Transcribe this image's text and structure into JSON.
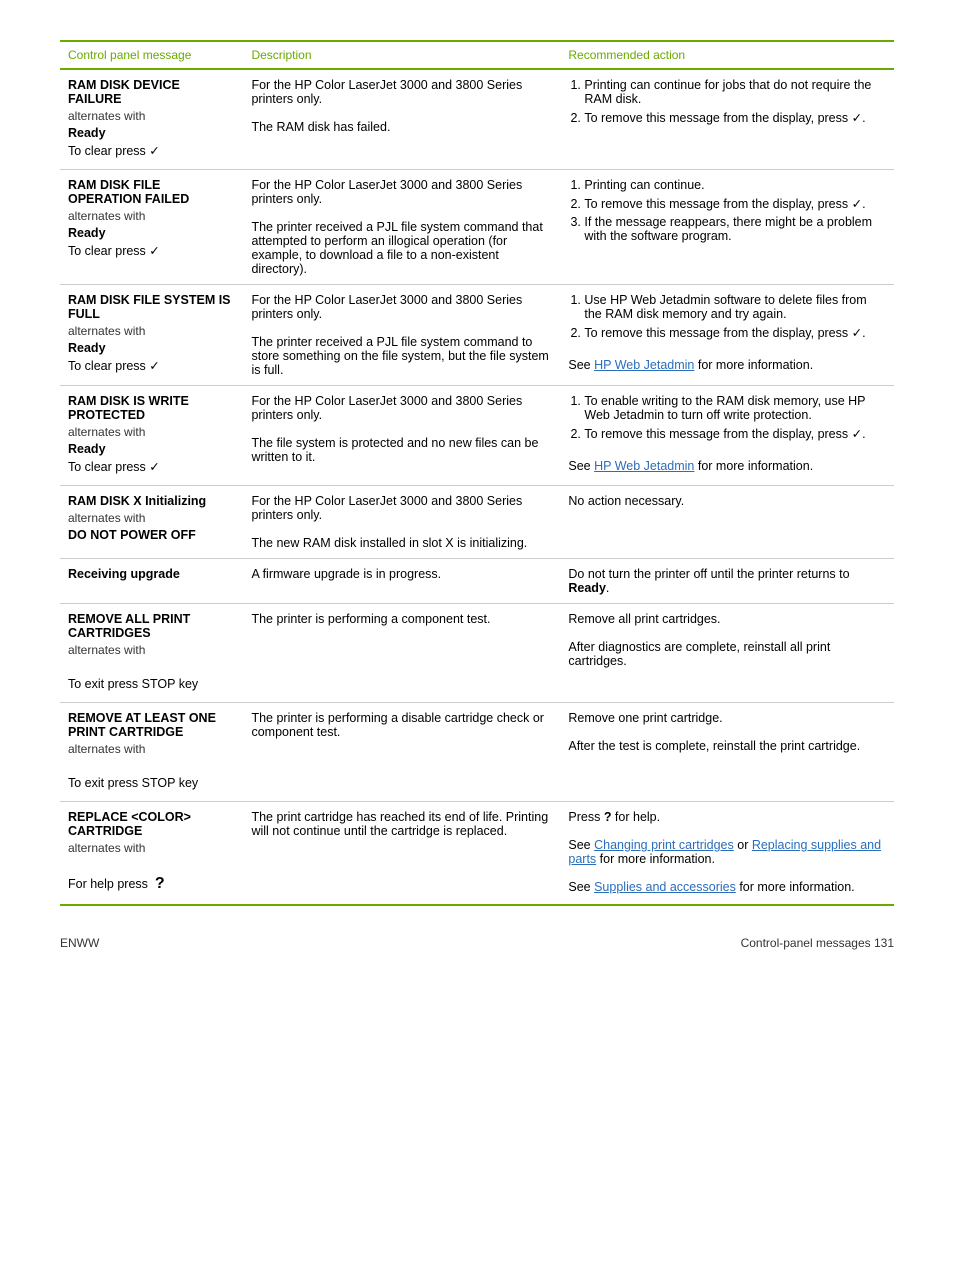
{
  "table": {
    "headers": {
      "col1": "Control panel message",
      "col2": "Description",
      "col3": "Recommended action"
    },
    "rows": [
      {
        "id": "row1",
        "col1": {
          "main": "RAM DISK DEVICE FAILURE",
          "alternates": "alternates with",
          "sub": "Ready",
          "clear": "To clear press ✓"
        },
        "col2": {
          "lines": [
            "For the HP Color LaserJet 3000 and 3800 Series printers only.",
            "",
            "The RAM disk has failed."
          ]
        },
        "col3": {
          "items": [
            "Printing can continue for jobs that do not require the RAM disk.",
            "To remove this message from the display, press ✓."
          ],
          "extra": ""
        }
      },
      {
        "id": "row2",
        "col1": {
          "main": "RAM DISK FILE OPERATION FAILED",
          "alternates": "alternates with",
          "sub": "Ready",
          "clear": "To clear press ✓"
        },
        "col2": {
          "lines": [
            "For the HP Color LaserJet 3000 and 3800 Series printers only.",
            "",
            "The printer received a PJL file system command that attempted to perform an illogical operation (for example, to download a file to a non-existent directory)."
          ]
        },
        "col3": {
          "items": [
            "Printing can continue.",
            "To remove this message from the display, press ✓.",
            "If the message reappears, there might be a problem with the software program."
          ],
          "extra": ""
        }
      },
      {
        "id": "row3",
        "col1": {
          "main": "RAM DISK FILE SYSTEM IS FULL",
          "alternates": "alternates with",
          "sub": "Ready",
          "clear": "To clear press ✓"
        },
        "col2": {
          "lines": [
            "For the HP Color LaserJet 3000 and 3800 Series printers only.",
            "",
            "The printer received a PJL file system command to store something on the file system, but the file system is full."
          ]
        },
        "col3": {
          "items": [
            "Use HP Web Jetadmin software to delete files from the RAM disk memory and try again.",
            "To remove this message from the display, press ✓."
          ],
          "extra": "See HP Web Jetadmin for more information."
        }
      },
      {
        "id": "row4",
        "col1": {
          "main": "RAM DISK IS WRITE PROTECTED",
          "alternates": "alternates with",
          "sub": "Ready",
          "clear": "To clear press ✓"
        },
        "col2": {
          "lines": [
            "For the HP Color LaserJet 3000 and 3800 Series printers only.",
            "",
            "The file system is protected and no new files can be written to it."
          ]
        },
        "col3": {
          "items": [
            "To enable writing to the RAM disk memory, use HP Web Jetadmin to turn off write protection.",
            "To remove this message from the display, press ✓."
          ],
          "extra": "See HP Web Jetadmin for more information."
        }
      },
      {
        "id": "row5",
        "col1": {
          "main": "RAM DISK X Initializing",
          "alternates": "alternates with",
          "sub": "DO NOT POWER OFF",
          "clear": ""
        },
        "col2": {
          "lines": [
            "For the HP Color LaserJet 3000 and 3800 Series printers only.",
            "",
            "The new RAM disk installed in slot X is initializing."
          ]
        },
        "col3": {
          "items": [],
          "extra": "No action necessary."
        }
      },
      {
        "id": "row6",
        "col1": {
          "main": "Receiving upgrade",
          "alternates": "",
          "sub": "",
          "clear": ""
        },
        "col2": {
          "lines": [
            "A firmware upgrade is in progress."
          ]
        },
        "col3": {
          "items": [],
          "extra": "Do not turn the printer off until the printer returns to Ready."
        }
      },
      {
        "id": "row7",
        "col1": {
          "main": "REMOVE ALL PRINT CARTRIDGES",
          "alternates": "alternates with",
          "sub": "",
          "clear": "To exit press STOP key"
        },
        "col2": {
          "lines": [
            "The printer is performing a component test."
          ]
        },
        "col3": {
          "items": [],
          "extra_lines": [
            "Remove all print cartridges.",
            "",
            "After diagnostics are complete, reinstall all print cartridges."
          ]
        }
      },
      {
        "id": "row8",
        "col1": {
          "main": "REMOVE AT LEAST ONE PRINT CARTRIDGE",
          "alternates": "alternates with",
          "sub": "",
          "clear": "To exit press STOP key"
        },
        "col2": {
          "lines": [
            "The printer is performing a disable cartridge check or component test."
          ]
        },
        "col3": {
          "items": [],
          "extra_lines": [
            "Remove one print cartridge.",
            "",
            "After the test is complete, reinstall the print cartridge."
          ]
        }
      },
      {
        "id": "row9",
        "col1": {
          "main": "REPLACE <COLOR> CARTRIDGE",
          "alternates": "alternates with",
          "sub": "",
          "clear": "For help press  ?"
        },
        "col2": {
          "lines": [
            "The print cartridge has reached its end of life. Printing will not continue until the cartridge is replaced."
          ]
        },
        "col3": {
          "items": [],
          "extra": ""
        }
      }
    ]
  },
  "footer": {
    "left": "ENWW",
    "right": "Control-panel messages     131"
  },
  "links": {
    "hp_web_jetadmin": "HP Web Jetadmin",
    "changing_print_cartridges": "Changing print cartridges",
    "replacing_supplies_and_parts": "Replacing supplies and parts",
    "supplies_and_accessories": "Supplies and accessories"
  }
}
